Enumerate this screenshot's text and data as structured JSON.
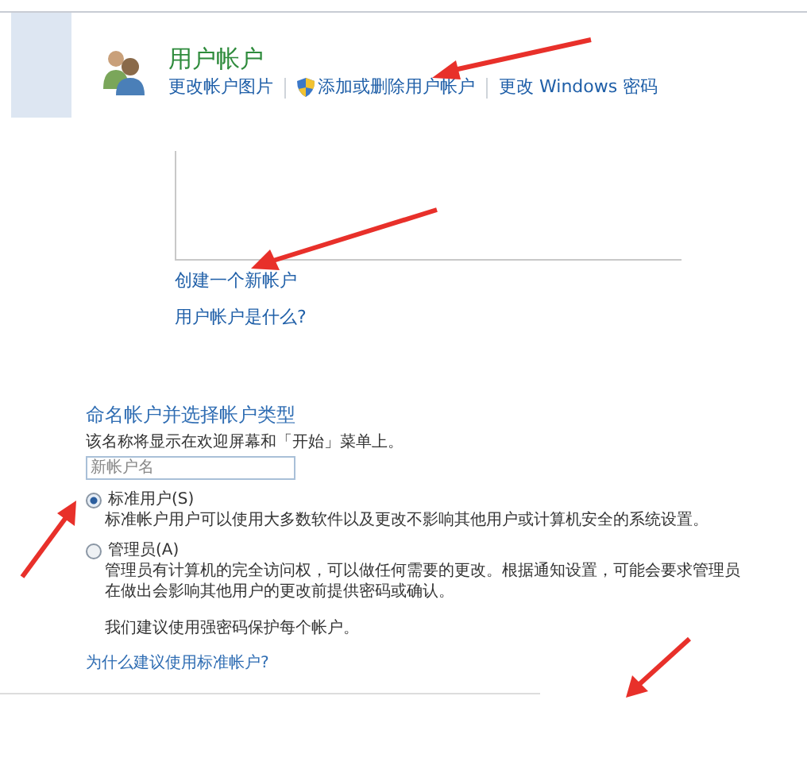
{
  "header": {
    "title": "用户帐户",
    "links": [
      {
        "label": "更改帐户图片",
        "shield": false
      },
      {
        "label": "添加或删除用户帐户",
        "shield": true
      },
      {
        "label": "更改 Windows 密码",
        "shield": false
      }
    ]
  },
  "account_links": [
    "创建一个新帐户",
    "用户帐户是什么?"
  ],
  "new_account": {
    "title": "命名帐户并选择帐户类型",
    "hint": "该名称将显示在欢迎屏幕和「开始」菜单上。",
    "name_field": {
      "placeholder": "新帐户名"
    },
    "types": [
      {
        "label": "标准用户(S)",
        "description": "标准帐户用户可以使用大多数软件以及更改不影响其他用户或计算机安全的系统设置。",
        "selected": true
      },
      {
        "label": "管理员(A)",
        "description": "管理员有计算机的完全访问权，可以做任何需要的更改。根据通知设置，可能会要求管理员在做出会影响其他用户的更改前提供密码或确认。",
        "selected": false
      }
    ],
    "note": "我们建议使用强密码保护每个帐户。",
    "help_link": "为什么建议使用标准帐户?"
  }
}
